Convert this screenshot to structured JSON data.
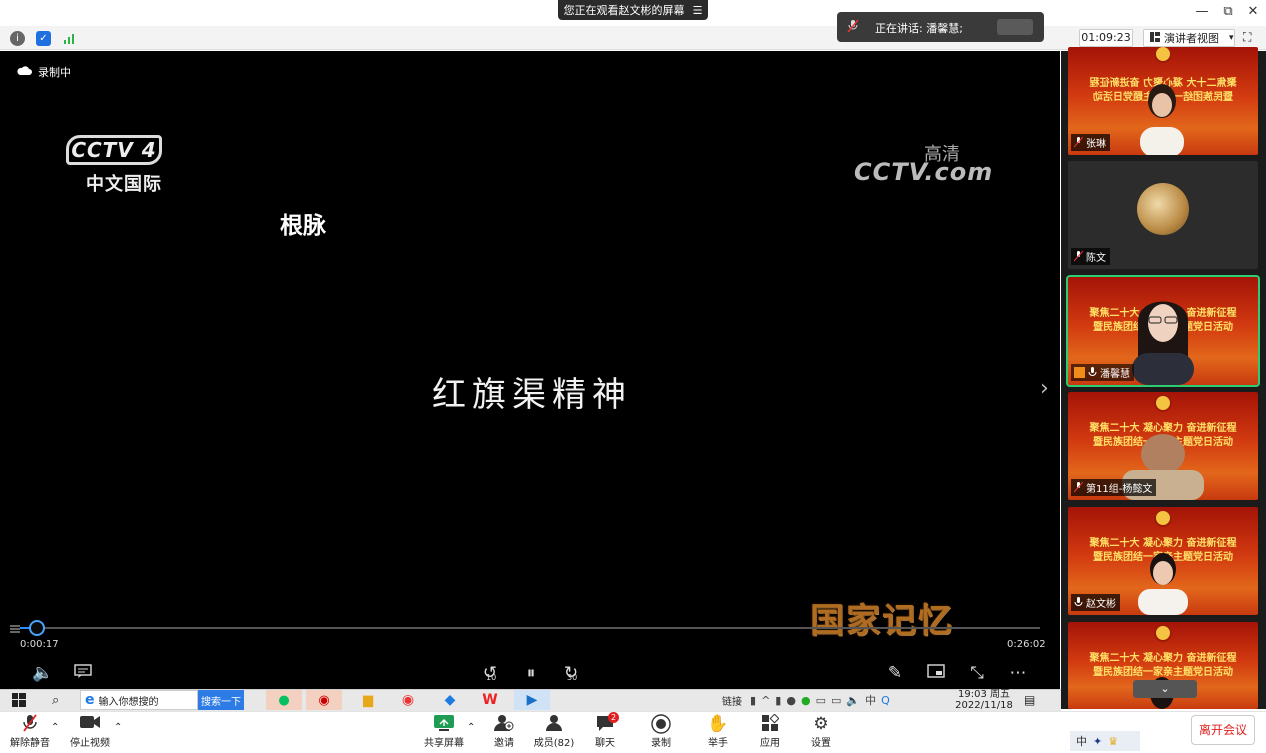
{
  "window": {
    "share_banner": "您正在观看赵文彬的屏幕",
    "banner_menu": "☰",
    "minimize": "—",
    "restore": "⧉",
    "close": "✕"
  },
  "toolbar": {
    "info_icon": "i",
    "shield_icon": "✓",
    "signal_icon": "▮"
  },
  "speaking": {
    "label": "正在讲话: 潘馨慧;"
  },
  "topright": {
    "timer": "01:09:23",
    "view_label": "演讲者视图",
    "view_caret": "▾",
    "fullscreen": "⛶"
  },
  "video": {
    "recording_label": "录制中",
    "cctv4_logo": "CCTV 4",
    "cctv4_sub": "中文国际",
    "cctvcom_logo": "CCTV.com",
    "cctvcom_hd": "高清",
    "title_text": "根脉",
    "subtitle": "红旗渠精神",
    "program_logo": "国家记忆",
    "progress_fraction": 0.017,
    "time_current": "0:00:17",
    "time_total": "0:26:02",
    "controls": {
      "volume": "🔈",
      "subtitles": "▭",
      "rewind": "↺",
      "rewind_sec": "10",
      "pause": "⏸",
      "forward": "↻",
      "forward_sec": "30",
      "pen": "✎",
      "pip": "▭",
      "shrink": "⤡",
      "more": "⋯"
    },
    "side_arrow": "›"
  },
  "participants": [
    {
      "name": "张琳",
      "banner1": "聚焦二十大 凝心聚力 奋进新征程",
      "banner2": "暨民族团结一家亲主题党日活动",
      "type": "red"
    },
    {
      "name": "陈文",
      "type": "dark"
    },
    {
      "name": "潘馨慧",
      "banner1": "聚焦二十大 凝心聚力 奋进新征程",
      "banner2": "暨民族团结一家亲主题党日活动",
      "type": "red",
      "active": true
    },
    {
      "name": "第11组-杨懿文",
      "banner1": "聚焦二十大 凝心聚力 奋进新征程",
      "banner2": "暨民族团结一家亲主题党日活动",
      "type": "red"
    },
    {
      "name": "赵文彬",
      "banner1": "聚焦二十大 凝心聚力 奋进新征程",
      "banner2": "暨民族团结一家亲主题党日活动",
      "type": "red"
    },
    {
      "name": "",
      "banner1": "聚焦二十大 凝心聚力 奋进新征程",
      "banner2": "暨民族团结一家亲主题党日活动",
      "type": "red"
    }
  ],
  "scroll_down": "⌄",
  "taskbar": {
    "search_placeholder": "输入你想搜的",
    "search_button": "搜索一下",
    "link_label": "链接",
    "clock_time": "19:03 周五",
    "clock_date": "2022/11/18",
    "input_lang": "中"
  },
  "controls": {
    "mute": "解除静音",
    "video": "停止视频",
    "share": "共享屏幕",
    "invite": "邀请",
    "members": "成员(82)",
    "chat": "聊天",
    "chat_badge": "2",
    "record": "录制",
    "raise_hand": "举手",
    "apps": "应用",
    "settings": "设置",
    "leave": "离开会议"
  },
  "ime": {
    "lang": "中"
  },
  "colors": {
    "accent": "#2d8cff",
    "leave": "#e02020",
    "active_border": "#2ecc71",
    "banner_text": "#ffe066"
  }
}
